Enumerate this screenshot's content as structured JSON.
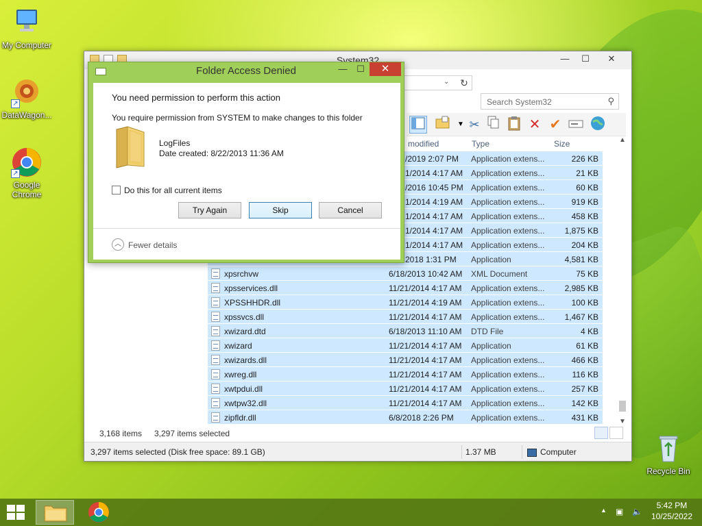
{
  "desktop": {
    "icons": [
      {
        "label": "My Computer"
      },
      {
        "label": "DataWagon..."
      },
      {
        "label": "Google Chrome"
      },
      {
        "label": "Recycle Bin"
      }
    ]
  },
  "explorer": {
    "title": "System32",
    "search_placeholder": "Search System32",
    "columns": {
      "date": "modified",
      "type": "Type",
      "size": "Size"
    },
    "rows_partial": [
      {
        "date": "/2019 2:07 PM",
        "type": "Application extens...",
        "size": "226 KB"
      },
      {
        "date": "1/2014 4:17 AM",
        "type": "Application extens...",
        "size": "21 KB"
      },
      {
        "date": "/2016 10:45 PM",
        "type": "Application extens...",
        "size": "60 KB"
      },
      {
        "date": "1/2014 4:19 AM",
        "type": "Application extens...",
        "size": "919 KB"
      },
      {
        "date": "1/2014 4:17 AM",
        "type": "Application extens...",
        "size": "458 KB"
      },
      {
        "date": "1/2014 4:17 AM",
        "type": "Application extens...",
        "size": "1,875 KB"
      },
      {
        "date": "1/2014 4:17 AM",
        "type": "Application extens...",
        "size": "204 KB"
      },
      {
        "date": "2018 1:31 PM",
        "type": "Application",
        "size": "4,581 KB"
      }
    ],
    "rows": [
      {
        "name": "xpsrchvw",
        "date": "6/18/2013 10:42 AM",
        "type": "XML Document",
        "size": "75 KB"
      },
      {
        "name": "xpsservices.dll",
        "date": "11/21/2014 4:17 AM",
        "type": "Application extens...",
        "size": "2,985 KB"
      },
      {
        "name": "XPSSHHDR.dll",
        "date": "11/21/2014 4:19 AM",
        "type": "Application extens...",
        "size": "100 KB"
      },
      {
        "name": "xpssvcs.dll",
        "date": "11/21/2014 4:17 AM",
        "type": "Application extens...",
        "size": "1,467 KB"
      },
      {
        "name": "xwizard.dtd",
        "date": "6/18/2013 11:10 AM",
        "type": "DTD File",
        "size": "4 KB"
      },
      {
        "name": "xwizard",
        "date": "11/21/2014 4:17 AM",
        "type": "Application",
        "size": "61 KB"
      },
      {
        "name": "xwizards.dll",
        "date": "11/21/2014 4:17 AM",
        "type": "Application extens...",
        "size": "466 KB"
      },
      {
        "name": "xwreg.dll",
        "date": "11/21/2014 4:17 AM",
        "type": "Application extens...",
        "size": "116 KB"
      },
      {
        "name": "xwtpdui.dll",
        "date": "11/21/2014 4:17 AM",
        "type": "Application extens...",
        "size": "257 KB"
      },
      {
        "name": "xwtpw32.dll",
        "date": "11/21/2014 4:17 AM",
        "type": "Application extens...",
        "size": "142 KB"
      },
      {
        "name": "zipfldr.dll",
        "date": "6/8/2018 2:26 PM",
        "type": "Application extens...",
        "size": "431 KB"
      }
    ],
    "status_items": "3,168 items",
    "status_selected": "3,297 items selected",
    "statusbar_main": "3,297 items selected (Disk free space: 89.1 GB)",
    "statusbar_size": "1.37 MB",
    "statusbar_location": "Computer"
  },
  "dialog": {
    "title": "Folder Access Denied",
    "line1": "You need permission to perform this action",
    "line2": "You require permission from SYSTEM to make changes to this folder",
    "folder_name": "LogFiles",
    "folder_date": "Date created: 8/22/2013 11:36 AM",
    "checkbox_label": "Do this for all current items",
    "btn_try_again": "Try Again",
    "btn_skip": "Skip",
    "btn_cancel": "Cancel",
    "fewer_details": "Fewer details"
  },
  "taskbar": {
    "time": "5:42 PM",
    "date": "10/25/2022"
  }
}
